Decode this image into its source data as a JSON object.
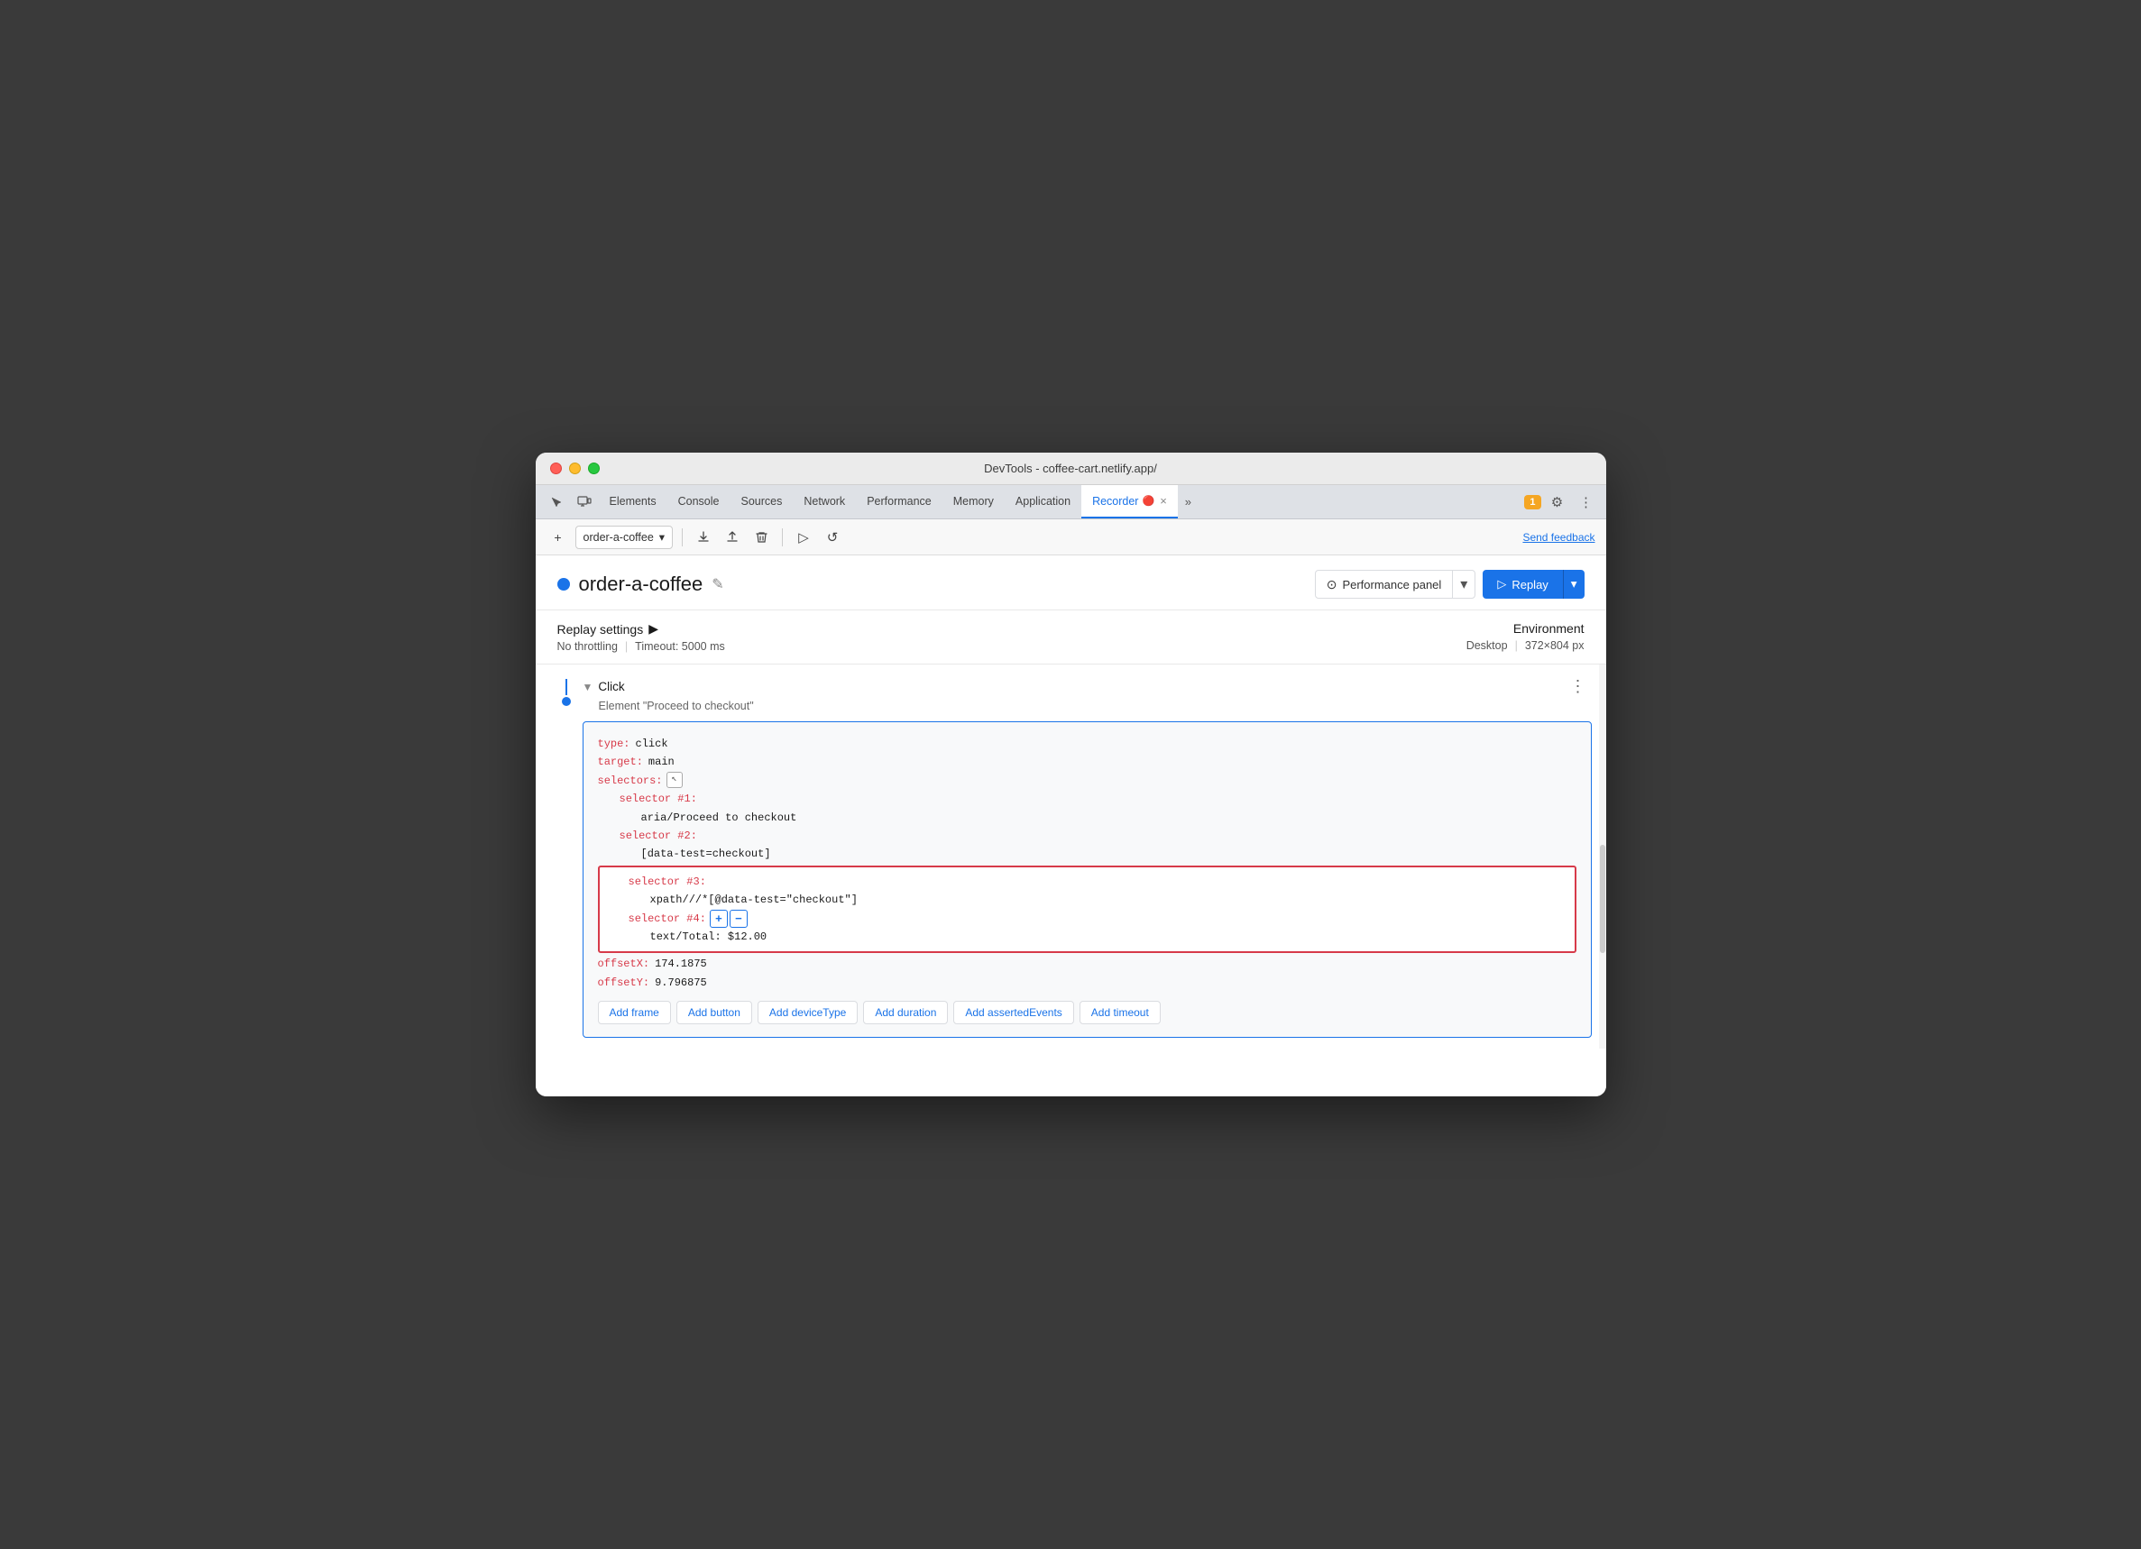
{
  "window": {
    "title": "DevTools - coffee-cart.netlify.app/"
  },
  "traffic_lights": {
    "red": "close",
    "yellow": "minimize",
    "green": "fullscreen"
  },
  "devtools_tabs": {
    "items": [
      {
        "label": "Elements",
        "active": false
      },
      {
        "label": "Console",
        "active": false
      },
      {
        "label": "Sources",
        "active": false
      },
      {
        "label": "Network",
        "active": false
      },
      {
        "label": "Performance",
        "active": false
      },
      {
        "label": "Memory",
        "active": false
      },
      {
        "label": "Application",
        "active": false
      },
      {
        "label": "Recorder 🔴",
        "active": true
      },
      {
        "label": "×",
        "active": false
      }
    ],
    "more_label": "»",
    "badge": "1",
    "settings_icon": "⚙",
    "more_icon": "⋮"
  },
  "toolbar": {
    "new_recording": "+",
    "recording_name": "order-a-coffee",
    "chevron_down": "▾",
    "export": "↑",
    "import": "↓",
    "delete": "🗑",
    "play": "▷",
    "replay_icon": "↺",
    "send_feedback": "Send feedback"
  },
  "recording_header": {
    "title": "order-a-coffee",
    "edit_icon": "✎",
    "performance_panel_label": "Performance panel",
    "performance_panel_icon": "⊙",
    "replay_label": "Replay",
    "replay_play_icon": "▷"
  },
  "settings": {
    "title": "Replay settings",
    "arrow": "▶",
    "throttling": "No throttling",
    "timeout": "Timeout: 5000 ms",
    "environment_title": "Environment",
    "environment_value": "Desktop",
    "resolution": "372×804 px"
  },
  "step": {
    "type": "Click",
    "subtitle": "Element \"Proceed to checkout\"",
    "more_icon": "⋮",
    "code": {
      "type_key": "type:",
      "type_val": "click",
      "target_key": "target:",
      "target_val": "main",
      "selectors_key": "selectors:",
      "selector1_key": "selector #1:",
      "selector1_val": "aria/Proceed to checkout",
      "selector2_key": "selector #2:",
      "selector2_val": "[data-test=checkout]",
      "selector3_key": "selector #3:",
      "selector3_val": "xpath///*[@data-test=\"checkout\"]",
      "selector4_key": "selector #4:",
      "selector4_val": "text/Total: $12.00",
      "offsetX_key": "offsetX:",
      "offsetX_val": "174.1875",
      "offsetY_key": "offsetY:",
      "offsetY_val": "9.796875"
    }
  },
  "action_buttons": [
    {
      "label": "Add frame"
    },
    {
      "label": "Add button"
    },
    {
      "label": "Add deviceType"
    },
    {
      "label": "Add duration"
    },
    {
      "label": "Add assertedEvents"
    },
    {
      "label": "Add timeout"
    }
  ]
}
